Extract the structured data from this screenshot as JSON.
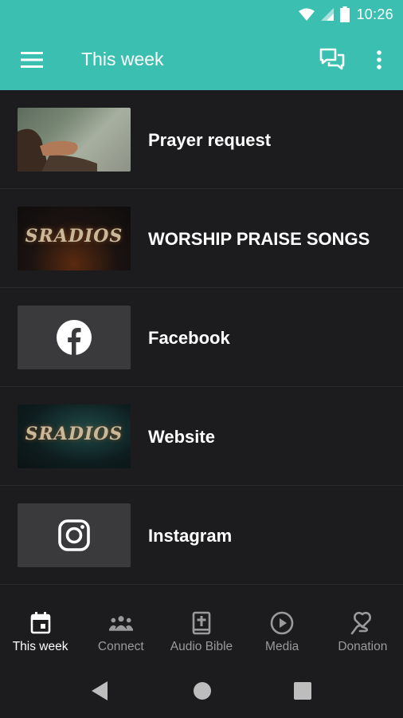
{
  "status_bar": {
    "time": "10:26"
  },
  "app_bar": {
    "title": "This week"
  },
  "items": [
    {
      "label": "Prayer request",
      "thumb": "photo-hands-lake"
    },
    {
      "label": "WORSHIP PRAISE SONGS",
      "thumb": "sradios-logo-fire",
      "logo_text": "SRADIOS"
    },
    {
      "label": "Facebook",
      "thumb": "facebook-icon"
    },
    {
      "label": "Website",
      "thumb": "sradios-logo-teal",
      "logo_text": "SRADIOS"
    },
    {
      "label": "Instagram",
      "thumb": "instagram-icon"
    }
  ],
  "bottom_nav": [
    {
      "label": "This week",
      "icon": "calendar-icon",
      "active": true
    },
    {
      "label": "Connect",
      "icon": "people-icon",
      "active": false
    },
    {
      "label": "Audio Bible",
      "icon": "bible-icon",
      "active": false
    },
    {
      "label": "Media",
      "icon": "play-circle-icon",
      "active": false
    },
    {
      "label": "Donation",
      "icon": "donation-icon",
      "active": false
    }
  ],
  "colors": {
    "accent": "#3bbfb1",
    "background": "#1c1c1e",
    "tile": "#3a3a3c",
    "inactive": "#9a9a9c"
  }
}
